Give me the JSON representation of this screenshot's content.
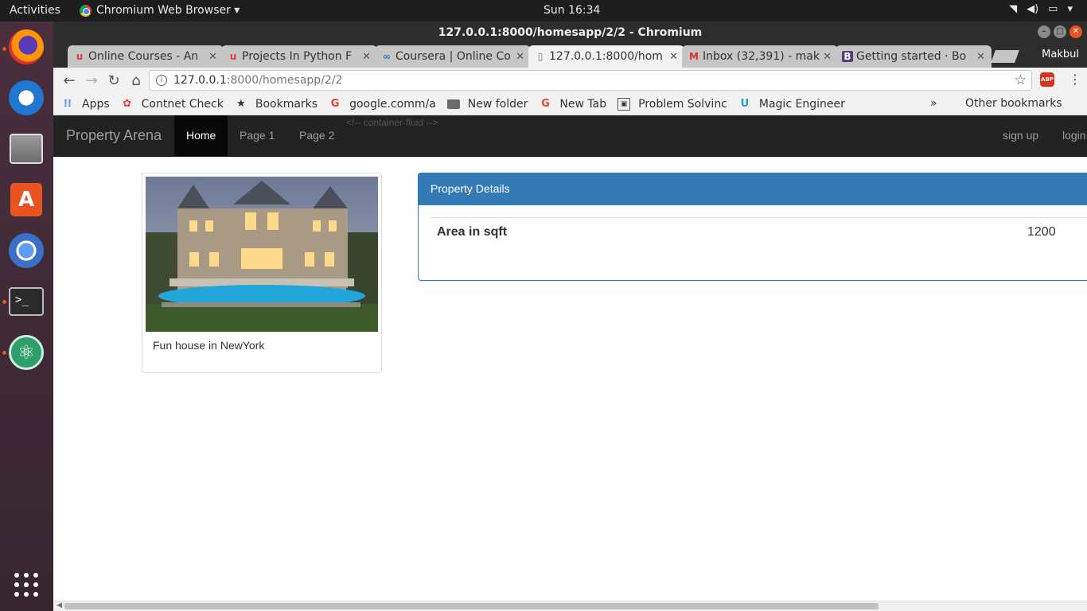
{
  "topbar": {
    "activities": "Activities",
    "app_menu": "Chromium Web Browser ▾",
    "clock": "Sun 16:34"
  },
  "window": {
    "title": "127.0.0.1:8000/homesapp/2/2 - Chromium",
    "profile_name": "Makbul"
  },
  "tabs": [
    {
      "label": "Online Courses - An",
      "favicon": "udemy-icon"
    },
    {
      "label": "Projects In Python F",
      "favicon": "udemy-icon"
    },
    {
      "label": "Coursera | Online Co",
      "favicon": "coursera-icon"
    },
    {
      "label": "127.0.0.1:8000/hom",
      "favicon": "page-icon",
      "active": true
    },
    {
      "label": "Inbox (32,391) - mak",
      "favicon": "gmail-icon"
    },
    {
      "label": "Getting started · Bo",
      "favicon": "bootstrap-icon"
    }
  ],
  "omnibox": {
    "url_host": "127.0.0.1",
    "url_rest": ":8000/homesapp/2/2"
  },
  "bookmarks": {
    "items": [
      {
        "label": "Apps",
        "icon": "apps-grid-icon"
      },
      {
        "label": "Contnet Check",
        "icon": "pinwheel-icon"
      },
      {
        "label": "Bookmarks",
        "icon": "star-icon"
      },
      {
        "label": "google.comm/a",
        "icon": "google-icon"
      },
      {
        "label": "New folder",
        "icon": "folder-icon"
      },
      {
        "label": "New Tab",
        "icon": "google-icon"
      },
      {
        "label": "Problem Solvinc",
        "icon": "problem-icon"
      },
      {
        "label": "Magic Engineer",
        "icon": "u-logo-icon"
      }
    ],
    "overflow": "»",
    "other": "Other bookmarks"
  },
  "site": {
    "brand": "Property Arena",
    "nav": [
      "Home",
      "Page 1",
      "Page 2"
    ],
    "ghost_text": "<!-- container-fluid -->",
    "right_nav": [
      "sign up",
      "login"
    ]
  },
  "property": {
    "caption": "Fun house in NewYork",
    "panel_heading": "Property Details",
    "rows": [
      {
        "label": "Area in sqft",
        "value": "1200"
      }
    ]
  },
  "colors": {
    "navbar_bg": "#222222",
    "panel_primary": "#337ab7",
    "dock_accent": "#e95420"
  }
}
